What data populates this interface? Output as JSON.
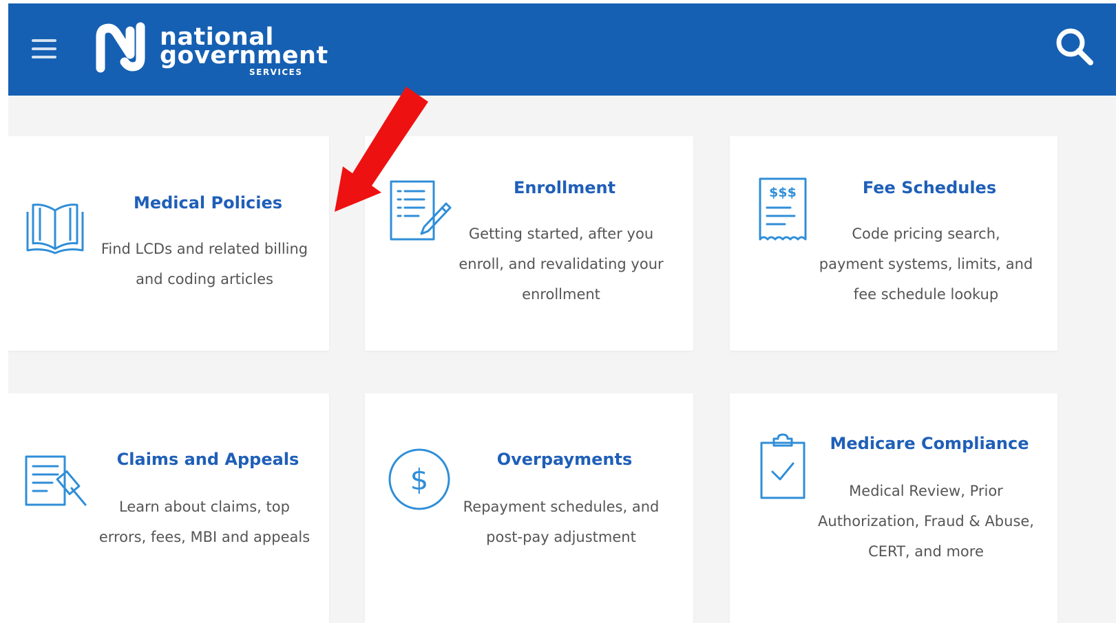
{
  "header": {
    "logo": {
      "line1": "national",
      "line2": "government",
      "line3": "SERVICES"
    }
  },
  "colors": {
    "header_bg": "#1560b3",
    "page_bg": "#f4f4f4",
    "card_bg": "#ffffff",
    "title": "#1f5fb8",
    "icon": "#2f8ed8",
    "text": "#555555",
    "arrow": "#ee1111"
  },
  "cards": [
    {
      "id": "medical-policies",
      "title": "Medical Policies",
      "icon": "open-book-icon",
      "desc": [
        "Find LCDs and related billing",
        "and coding articles"
      ]
    },
    {
      "id": "enrollment",
      "title": "Enrollment",
      "icon": "form-pencil-icon",
      "desc": [
        "Getting started, after you",
        "enroll, and revalidating your",
        "enrollment"
      ]
    },
    {
      "id": "fee-schedules",
      "title": "Fee Schedules",
      "icon": "receipt-icon",
      "desc": [
        "Code pricing search,",
        "payment systems, limits, and",
        "fee schedule lookup"
      ]
    },
    {
      "id": "claims-appeals",
      "title": "Claims and Appeals",
      "icon": "document-gavel-icon",
      "desc": [
        "Learn about claims, top",
        "errors, fees, MBI and appeals"
      ]
    },
    {
      "id": "overpayments",
      "title": "Overpayments",
      "icon": "dollar-circle-icon",
      "desc": [
        "Repayment schedules, and",
        "post-pay adjustment"
      ]
    },
    {
      "id": "medicare-compliance",
      "title": "Medicare Compliance",
      "icon": "clipboard-check-icon",
      "desc": [
        "Medical Review, Prior",
        "Authorization, Fraud & Abuse,",
        "CERT, and more"
      ]
    }
  ],
  "icons": {
    "menu": "hamburger-menu-icon",
    "search": "search-icon",
    "pointer": "red-arrow-icon"
  }
}
